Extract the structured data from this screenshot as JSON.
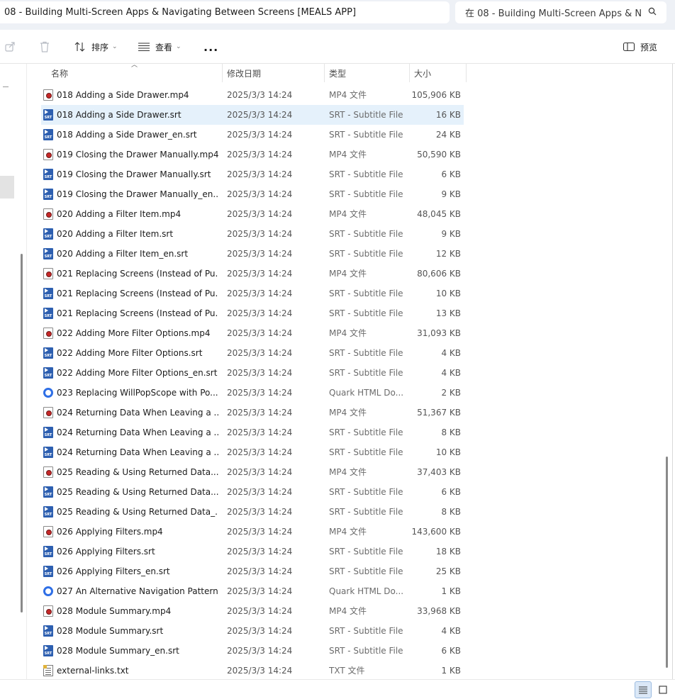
{
  "address": {
    "path": "08 - Building Multi-Screen Apps & Navigating Between Screens [MEALS APP]"
  },
  "search": {
    "placeholder": "在 08 - Building Multi-Screen Apps & N",
    "icon": "search-icon"
  },
  "toolbar": {
    "share_icon": "share-icon",
    "delete_icon": "delete-icon",
    "sort_label": "排序",
    "view_label": "查看",
    "more_label": "...",
    "preview_label": "预览"
  },
  "columns": {
    "name": "名称",
    "date": "修改日期",
    "type": "类型",
    "size": "大小"
  },
  "files": [
    {
      "name": "018 Adding a Side Drawer.mp4",
      "date": "2025/3/3 14:24",
      "type": "MP4 文件",
      "size": "105,906 KB",
      "icon": "mp4"
    },
    {
      "name": "018 Adding a Side Drawer.srt",
      "date": "2025/3/3 14:24",
      "type": "SRT - Subtitle File",
      "size": "16 KB",
      "icon": "srt",
      "selected": true
    },
    {
      "name": "018 Adding a Side Drawer_en.srt",
      "date": "2025/3/3 14:24",
      "type": "SRT - Subtitle File",
      "size": "24 KB",
      "icon": "srt"
    },
    {
      "name": "019 Closing the Drawer Manually.mp4",
      "date": "2025/3/3 14:24",
      "type": "MP4 文件",
      "size": "50,590 KB",
      "icon": "mp4"
    },
    {
      "name": "019 Closing the Drawer Manually.srt",
      "date": "2025/3/3 14:24",
      "type": "SRT - Subtitle File",
      "size": "6 KB",
      "icon": "srt"
    },
    {
      "name": "019 Closing the Drawer Manually_en....",
      "date": "2025/3/3 14:24",
      "type": "SRT - Subtitle File",
      "size": "9 KB",
      "icon": "srt"
    },
    {
      "name": "020 Adding a Filter Item.mp4",
      "date": "2025/3/3 14:24",
      "type": "MP4 文件",
      "size": "48,045 KB",
      "icon": "mp4"
    },
    {
      "name": "020 Adding a Filter Item.srt",
      "date": "2025/3/3 14:24",
      "type": "SRT - Subtitle File",
      "size": "9 KB",
      "icon": "srt"
    },
    {
      "name": "020 Adding a Filter Item_en.srt",
      "date": "2025/3/3 14:24",
      "type": "SRT - Subtitle File",
      "size": "12 KB",
      "icon": "srt"
    },
    {
      "name": "021 Replacing Screens (Instead of Pu...",
      "date": "2025/3/3 14:24",
      "type": "MP4 文件",
      "size": "80,606 KB",
      "icon": "mp4"
    },
    {
      "name": "021 Replacing Screens (Instead of Pu...",
      "date": "2025/3/3 14:24",
      "type": "SRT - Subtitle File",
      "size": "10 KB",
      "icon": "srt"
    },
    {
      "name": "021 Replacing Screens (Instead of Pu...",
      "date": "2025/3/3 14:24",
      "type": "SRT - Subtitle File",
      "size": "13 KB",
      "icon": "srt"
    },
    {
      "name": "022 Adding More Filter Options.mp4",
      "date": "2025/3/3 14:24",
      "type": "MP4 文件",
      "size": "31,093 KB",
      "icon": "mp4"
    },
    {
      "name": "022 Adding More Filter Options.srt",
      "date": "2025/3/3 14:24",
      "type": "SRT - Subtitle File",
      "size": "4 KB",
      "icon": "srt"
    },
    {
      "name": "022 Adding More Filter Options_en.srt",
      "date": "2025/3/3 14:24",
      "type": "SRT - Subtitle File",
      "size": "4 KB",
      "icon": "srt"
    },
    {
      "name": "023 Replacing WillPopScope with Po...",
      "date": "2025/3/3 14:24",
      "type": "Quark HTML Do...",
      "size": "2 KB",
      "icon": "html"
    },
    {
      "name": "024 Returning Data When Leaving a ...",
      "date": "2025/3/3 14:24",
      "type": "MP4 文件",
      "size": "51,367 KB",
      "icon": "mp4"
    },
    {
      "name": "024 Returning Data When Leaving a ...",
      "date": "2025/3/3 14:24",
      "type": "SRT - Subtitle File",
      "size": "8 KB",
      "icon": "srt"
    },
    {
      "name": "024 Returning Data When Leaving a ...",
      "date": "2025/3/3 14:24",
      "type": "SRT - Subtitle File",
      "size": "10 KB",
      "icon": "srt"
    },
    {
      "name": "025 Reading & Using Returned Data....",
      "date": "2025/3/3 14:24",
      "type": "MP4 文件",
      "size": "37,403 KB",
      "icon": "mp4"
    },
    {
      "name": "025 Reading & Using Returned Data....",
      "date": "2025/3/3 14:24",
      "type": "SRT - Subtitle File",
      "size": "6 KB",
      "icon": "srt"
    },
    {
      "name": "025 Reading & Using Returned Data_...",
      "date": "2025/3/3 14:24",
      "type": "SRT - Subtitle File",
      "size": "8 KB",
      "icon": "srt"
    },
    {
      "name": "026 Applying Filters.mp4",
      "date": "2025/3/3 14:24",
      "type": "MP4 文件",
      "size": "143,600 KB",
      "icon": "mp4"
    },
    {
      "name": "026 Applying Filters.srt",
      "date": "2025/3/3 14:24",
      "type": "SRT - Subtitle File",
      "size": "18 KB",
      "icon": "srt"
    },
    {
      "name": "026 Applying Filters_en.srt",
      "date": "2025/3/3 14:24",
      "type": "SRT - Subtitle File",
      "size": "25 KB",
      "icon": "srt"
    },
    {
      "name": "027 An Alternative Navigation Pattern...",
      "date": "2025/3/3 14:24",
      "type": "Quark HTML Do...",
      "size": "1 KB",
      "icon": "html"
    },
    {
      "name": "028 Module Summary.mp4",
      "date": "2025/3/3 14:24",
      "type": "MP4 文件",
      "size": "33,968 KB",
      "icon": "mp4"
    },
    {
      "name": "028 Module Summary.srt",
      "date": "2025/3/3 14:24",
      "type": "SRT - Subtitle File",
      "size": "4 KB",
      "icon": "srt"
    },
    {
      "name": "028 Module Summary_en.srt",
      "date": "2025/3/3 14:24",
      "type": "SRT - Subtitle File",
      "size": "6 KB",
      "icon": "srt"
    },
    {
      "name": "external-links.txt",
      "date": "2025/3/3 14:24",
      "type": "TXT 文件",
      "size": "1 KB",
      "icon": "txt"
    }
  ],
  "statusbar": {
    "details_view_icon": "details-view-icon",
    "tiles_view_icon": "tiles-view-icon"
  },
  "colors": {
    "selection": "#e5f1fb",
    "accent": "#2f6fe6",
    "srt_icon": "#2d5fb0",
    "mp4_dot": "#c62828"
  }
}
